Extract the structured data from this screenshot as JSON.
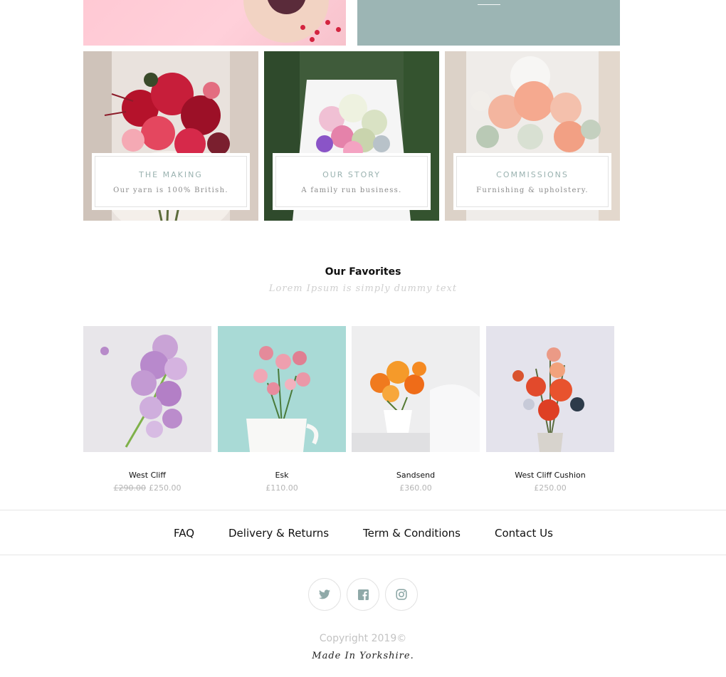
{
  "tiles": [
    {
      "title": "THE MAKING",
      "subtitle": "Our yarn is 100% British."
    },
    {
      "title": "OUR STORY",
      "subtitle": "A family run business."
    },
    {
      "title": "COMMISSIONS",
      "subtitle": "Furnishing & upholstery."
    }
  ],
  "favorites": {
    "title": "Our Favorites",
    "subtitle": "Lorem Ipsum is simply dummy text"
  },
  "products": [
    {
      "name": "West Cliff",
      "old_price": "£290.00",
      "price": "£250.00"
    },
    {
      "name": "Esk",
      "price": "£110.00"
    },
    {
      "name": "Sandsend",
      "price": "£360.00"
    },
    {
      "name": "West Cliff Cushion",
      "price": "£250.00"
    }
  ],
  "footer": {
    "nav": [
      "FAQ",
      "Delivery & Returns",
      "Term & Conditions",
      "Contact Us"
    ],
    "social_icons": [
      "twitter-icon",
      "facebook-icon",
      "instagram-icon"
    ],
    "copyright": "Copyright 2019©",
    "made_in": "Made In Yorkshire."
  },
  "colors": {
    "accent_teal": "#9cb5b4",
    "banner_pink": "#ffc9d4",
    "muted_text": "#b5b5b5"
  }
}
